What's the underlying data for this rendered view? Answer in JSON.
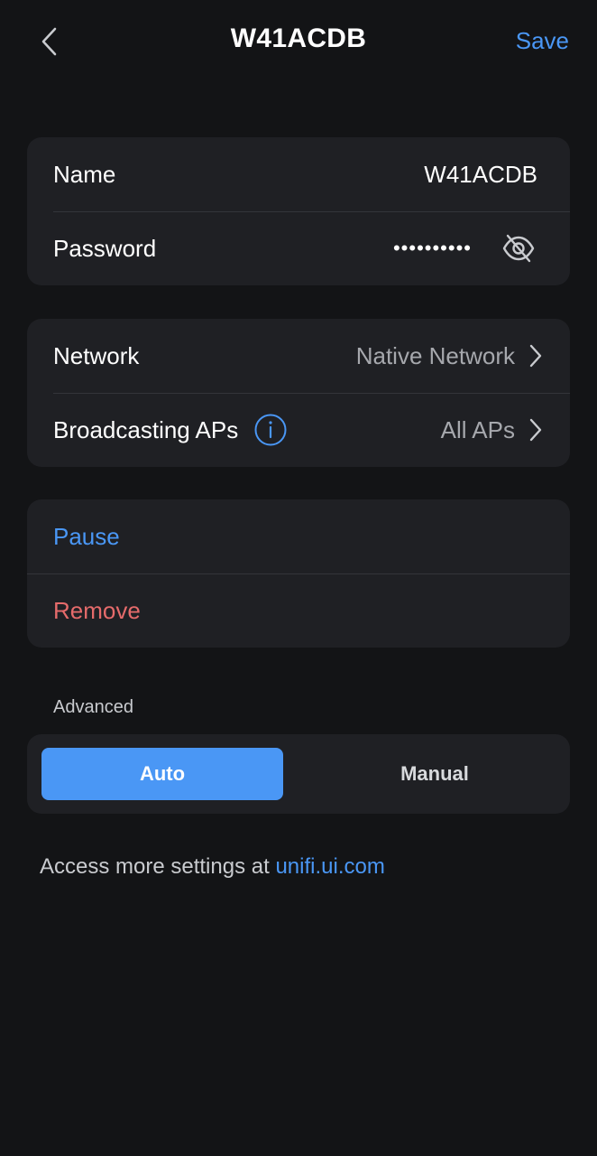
{
  "header": {
    "title": "W41ACDB",
    "save_label": "Save"
  },
  "credentials": {
    "name_label": "Name",
    "name_value": "W41ACDB",
    "password_label": "Password",
    "password_masked": "••••••••••"
  },
  "network_settings": {
    "network_label": "Network",
    "network_value": "Native Network",
    "broadcasting_label": "Broadcasting APs",
    "broadcasting_value": "All APs"
  },
  "actions": {
    "pause_label": "Pause",
    "remove_label": "Remove"
  },
  "advanced": {
    "section_label": "Advanced",
    "options": [
      "Auto",
      "Manual"
    ],
    "selected": "Auto"
  },
  "footer": {
    "text": "Access more settings at ",
    "link_text": "unifi.ui.com"
  },
  "colors": {
    "background": "#131416",
    "card": "#1f2024",
    "accent_blue": "#4a97f5",
    "danger_red": "#e56b6b"
  }
}
